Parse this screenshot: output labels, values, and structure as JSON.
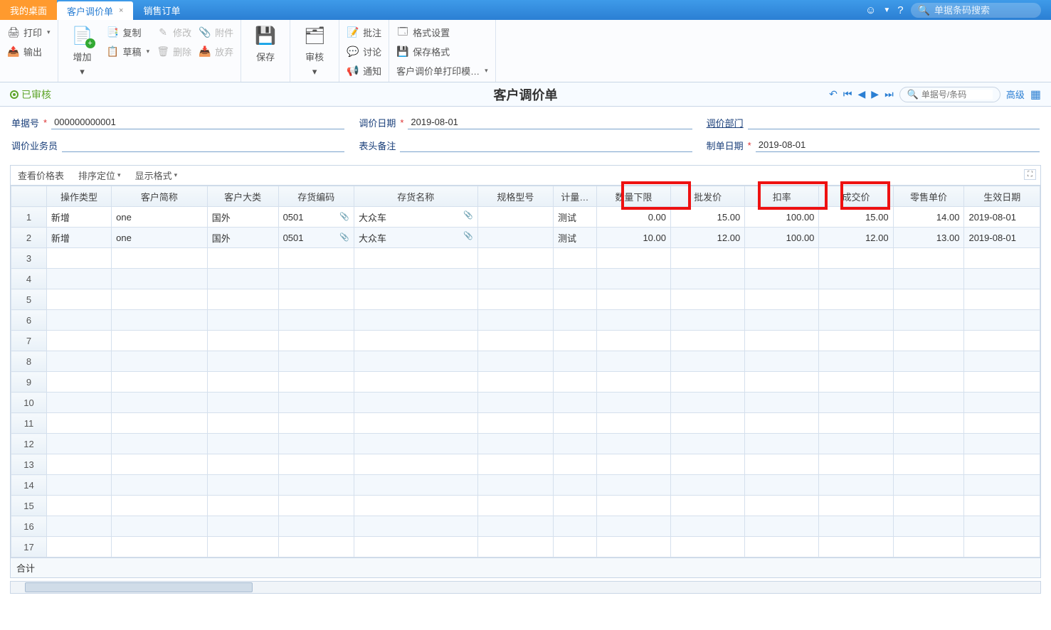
{
  "tabs": {
    "home": "我的桌面",
    "active": "客户调价单",
    "other": "销售订单"
  },
  "topSearchPlaceholder": "单据条码搜索",
  "ribbon": {
    "print": "打印",
    "output": "输出",
    "add": "增加",
    "copy": "复制",
    "draft": "草稿",
    "modify": "修改",
    "delete": "删除",
    "attach": "附件",
    "discard": "放弃",
    "save": "保存",
    "audit": "审核",
    "note": "批注",
    "discuss": "讨论",
    "notify": "通知",
    "formatSet": "格式设置",
    "saveFormat": "保存格式",
    "printTpl": "客户调价单打印模…"
  },
  "status": "已审核",
  "docTitle": "客户调价单",
  "navSearchPlaceholder": "单据号/条码",
  "advanced": "高级",
  "form": {
    "billNoLabel": "单据号",
    "billNo": "000000000001",
    "adjDateLabel": "调价日期",
    "adjDate": "2019-08-01",
    "deptLabel": "调价部门",
    "dept": "",
    "salesmanLabel": "调价业务员",
    "salesman": "",
    "remarkLabel": "表头备注",
    "remark": "",
    "makeDateLabel": "制单日期",
    "makeDate": "2019-08-01"
  },
  "tblToolbar": {
    "viewPrice": "查看价格表",
    "sort": "排序定位",
    "display": "显示格式"
  },
  "columns": {
    "op": "操作类型",
    "cust": "客户简称",
    "cat": "客户大类",
    "code": "存货编码",
    "name": "存货名称",
    "spec": "规格型号",
    "unit": "计量…",
    "qty": "数量下限",
    "wp": "批发价",
    "disc": "扣率",
    "deal": "成交价",
    "retail": "零售单价",
    "date": "生效日期"
  },
  "rows": [
    {
      "op": "新增",
      "cust": "one",
      "cat": "国外",
      "code": "0501",
      "name": "大众车",
      "spec": "",
      "unit": "测试",
      "qty": "0.00",
      "wp": "15.00",
      "disc": "100.00",
      "deal": "15.00",
      "retail": "14.00",
      "date": "2019-08-01"
    },
    {
      "op": "新增",
      "cust": "one",
      "cat": "国外",
      "code": "0501",
      "name": "大众车",
      "spec": "",
      "unit": "测试",
      "qty": "10.00",
      "wp": "12.00",
      "disc": "100.00",
      "deal": "12.00",
      "retail": "13.00",
      "date": "2019-08-01"
    }
  ],
  "totalLabel": "合计",
  "emptyRows": 15
}
